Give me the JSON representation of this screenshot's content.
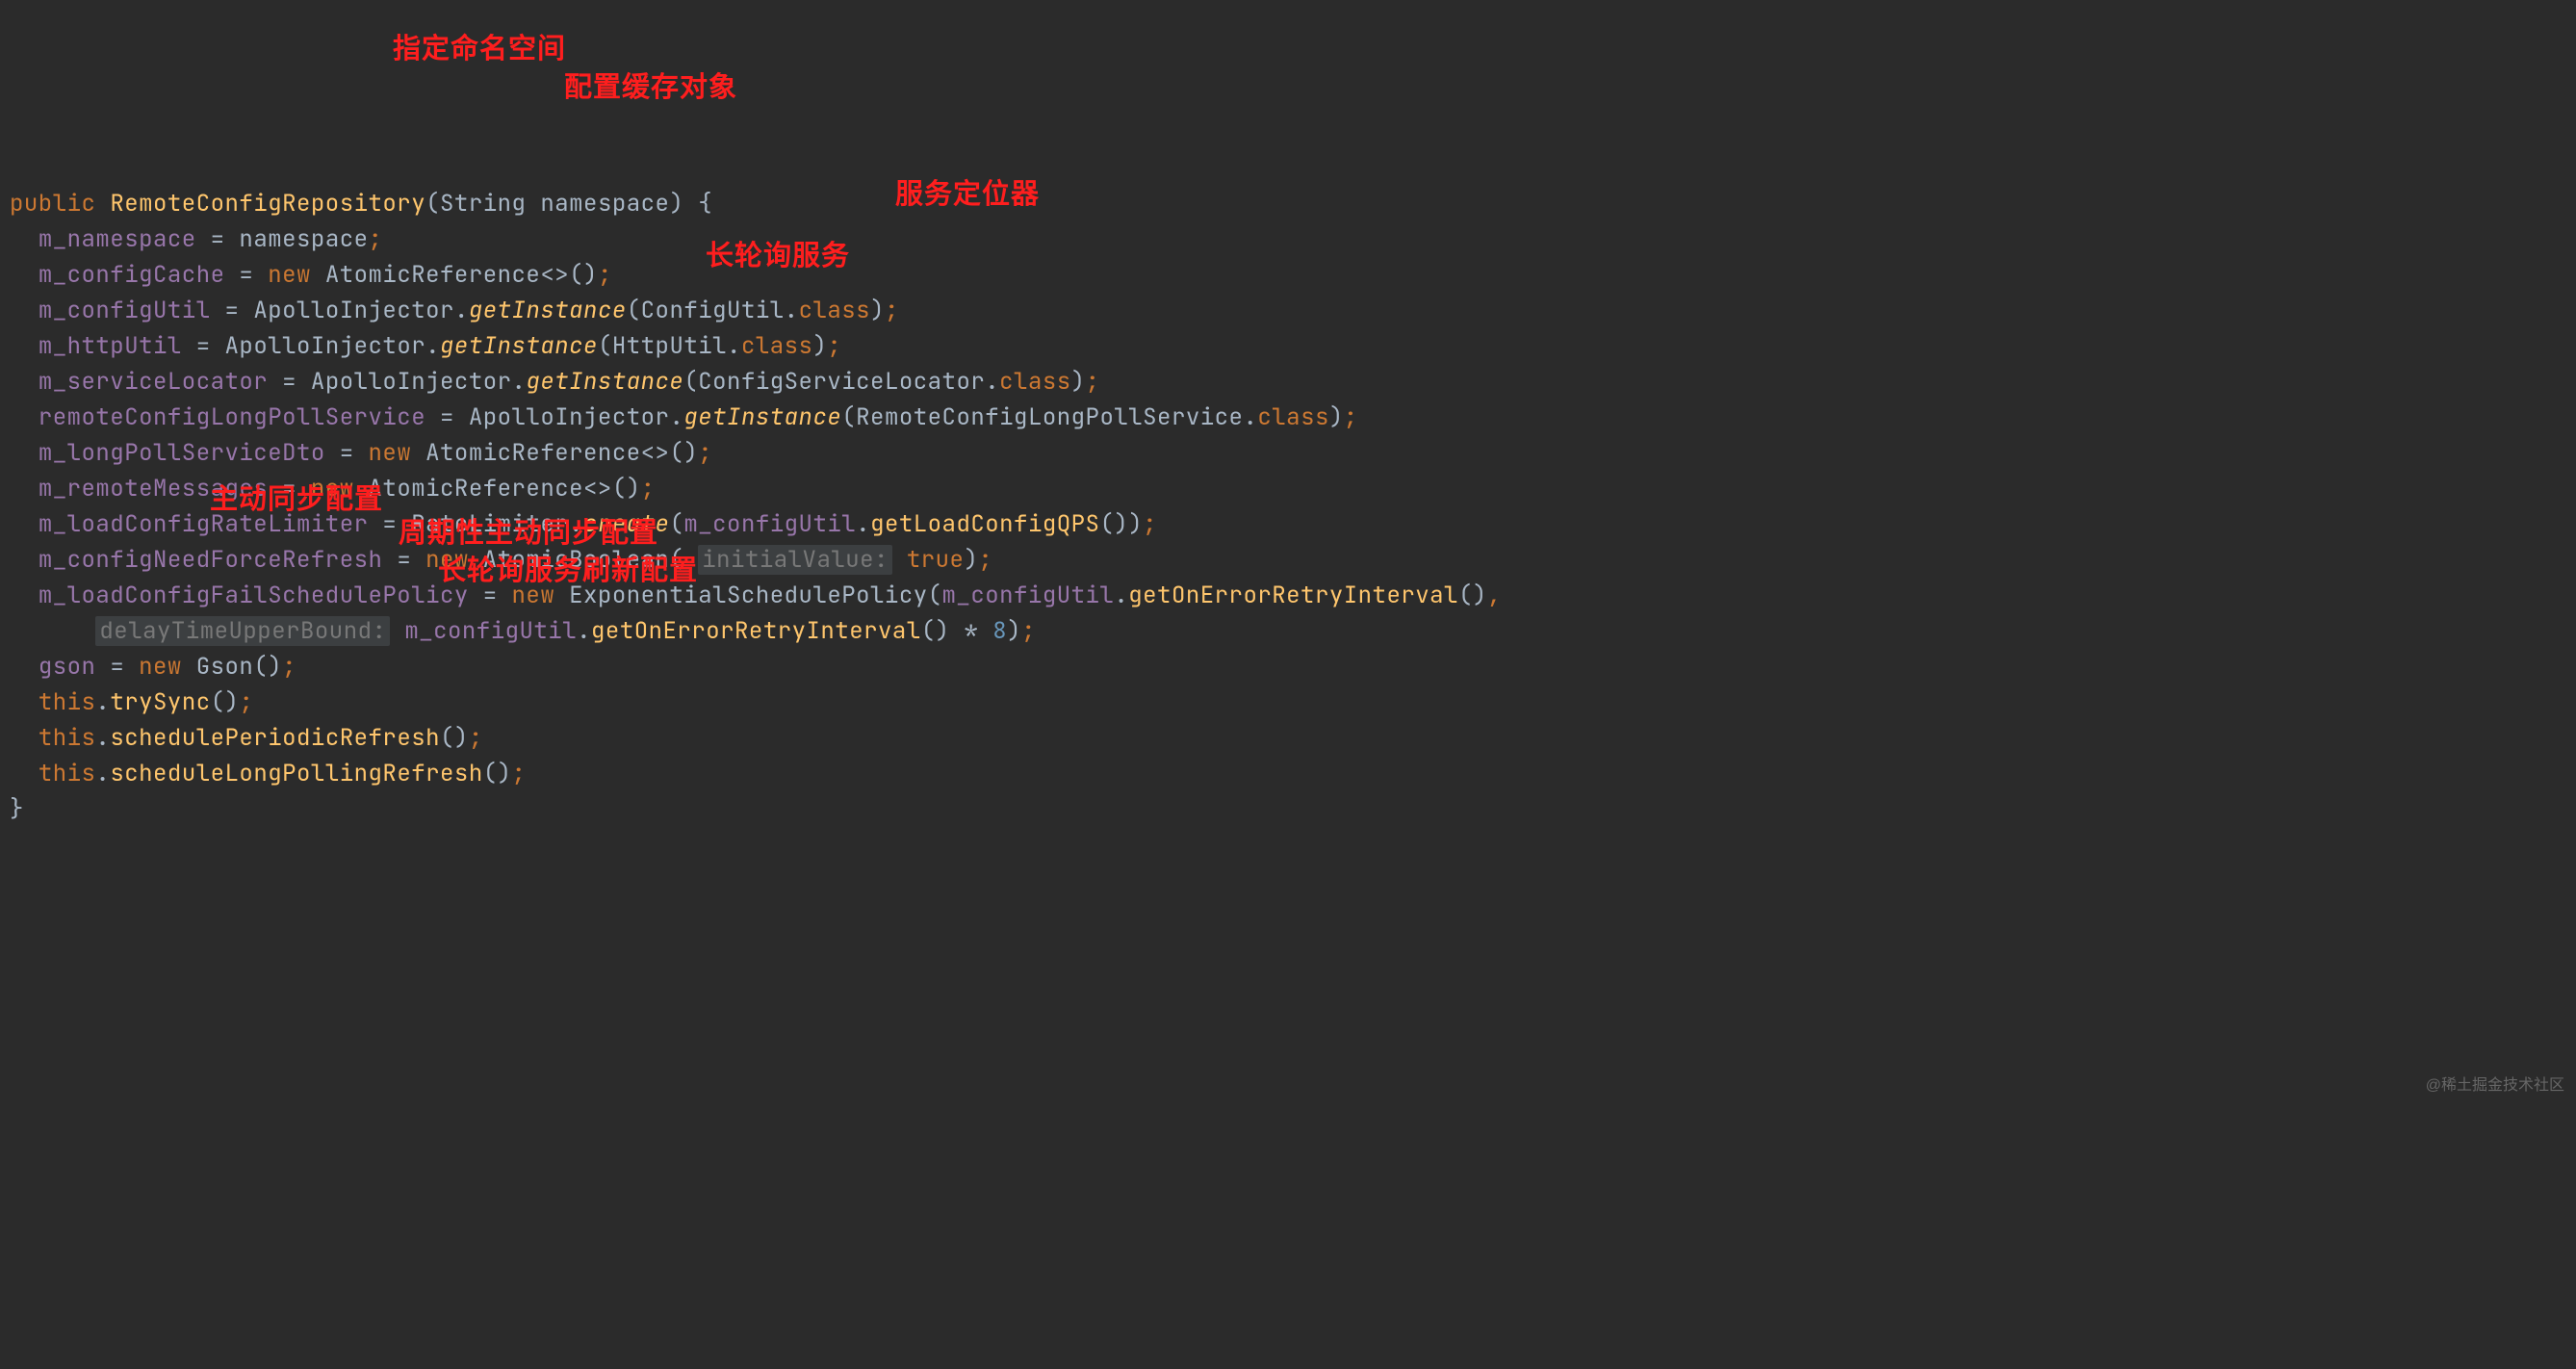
{
  "code": {
    "l1": {
      "kw_public": "public",
      "name": "RemoteConfigRepository",
      "param_type": "String",
      "param_name": "namespace",
      "brace": "{"
    },
    "l2": {
      "lhs": "m_namespace",
      "rhs": "namespace"
    },
    "l3": {
      "lhs": "m_configCache",
      "kw_new": "new",
      "ctor": "AtomicReference",
      "gen": "<>",
      "call": "()"
    },
    "l4": {
      "lhs": "m_configUtil",
      "cls": "ApolloInjector",
      "m": "getInstance",
      "arg_type": "ConfigUtil",
      "arg_suffix": ".class"
    },
    "l5": {
      "lhs": "m_httpUtil",
      "cls": "ApolloInjector",
      "m": "getInstance",
      "arg_type": "HttpUtil",
      "arg_suffix": ".class"
    },
    "l6": {
      "lhs": "m_serviceLocator",
      "cls": "ApolloInjector",
      "m": "getInstance",
      "arg_type": "ConfigServiceLocator",
      "arg_suffix": ".class"
    },
    "l7": {
      "lhs": "remoteConfigLongPollService",
      "cls": "ApolloInjector",
      "m": "getInstance",
      "arg_type": "RemoteConfigLongPollService",
      "arg_suffix": ".class"
    },
    "l8": {
      "lhs": "m_longPollServiceDto",
      "kw_new": "new",
      "ctor": "AtomicReference",
      "gen": "<>",
      "call": "()"
    },
    "l9": {
      "lhs": "m_remoteMessages",
      "kw_new": "new",
      "ctor": "AtomicReference",
      "gen": "<>",
      "call": "()"
    },
    "l10": {
      "lhs": "m_loadConfigRateLimiter",
      "cls": "RateLimiter",
      "m": "create",
      "arg_obj": "m_configUtil",
      "arg_call": "getLoadConfigQPS"
    },
    "l11": {
      "lhs": "m_configNeedForceRefresh",
      "kw_new": "new",
      "ctor": "AtomicBoolean",
      "hint": "initialValue:",
      "val": "true"
    },
    "l12": {
      "lhs": "m_loadConfigFailSchedulePolicy",
      "kw_new": "new",
      "ctor": "ExponentialSchedulePolicy",
      "arg1_obj": "m_configUtil",
      "arg1_call": "getOnErrorRetryInterval"
    },
    "l13": {
      "hint": "delayTimeUpperBound:",
      "obj": "m_configUtil",
      "call": "getOnErrorRetryInterval",
      "op": "*",
      "num": "8"
    },
    "l14": {
      "lhs": "gson",
      "kw_new": "new",
      "ctor": "Gson"
    },
    "l15": {
      "kw_this": "this",
      "call": "trySync"
    },
    "l16": {
      "kw_this": "this",
      "call": "schedulePeriodicRefresh"
    },
    "l17": {
      "kw_this": "this",
      "call": "scheduleLongPollingRefresh"
    },
    "l18": {
      "brace": "}"
    }
  },
  "annotations": {
    "a1": "指定命名空间",
    "a2": "配置缓存对象",
    "a3": "服务定位器",
    "a4": "长轮询服务",
    "a5": "主动同步配置",
    "a6": "周期性主动同步配置",
    "a7": "长轮询服务刷新配置"
  },
  "watermark": "@稀土掘金技术社区"
}
